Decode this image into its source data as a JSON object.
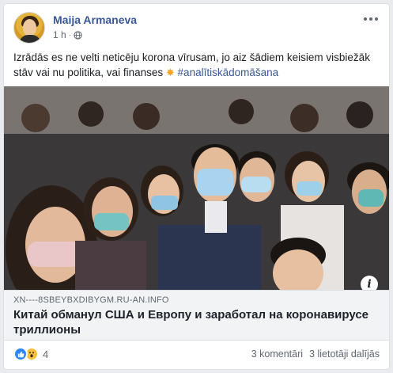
{
  "post": {
    "author": "Maija Armaneva",
    "time": "1 h",
    "separator": "·",
    "text": "Izrādās es ne velti neticēju korona vīrusam, jo aiz šādiem keisiem visbiežāk stāv vai nu politika, vai finanses",
    "emoji": "✸",
    "hashtag": "#analītiskādomāšana"
  },
  "link": {
    "domain": "XN----8SBEYBXDIBYGM.RU-AN.INFO",
    "title": "Китай обманул США и Европу и заработал на коронавирусе триллионы",
    "info_icon": "i"
  },
  "footer": {
    "reaction_count": "4",
    "comments": "3 komentāri",
    "shares": "3 lietotāji dalījās"
  },
  "icons": {
    "privacy": "globe-icon",
    "menu": "more-icon",
    "like": "like-reaction-icon",
    "wow": "wow-reaction-icon"
  },
  "colors": {
    "link": "#385898",
    "like": "#2d88ff",
    "wow": "#f7c13e"
  }
}
